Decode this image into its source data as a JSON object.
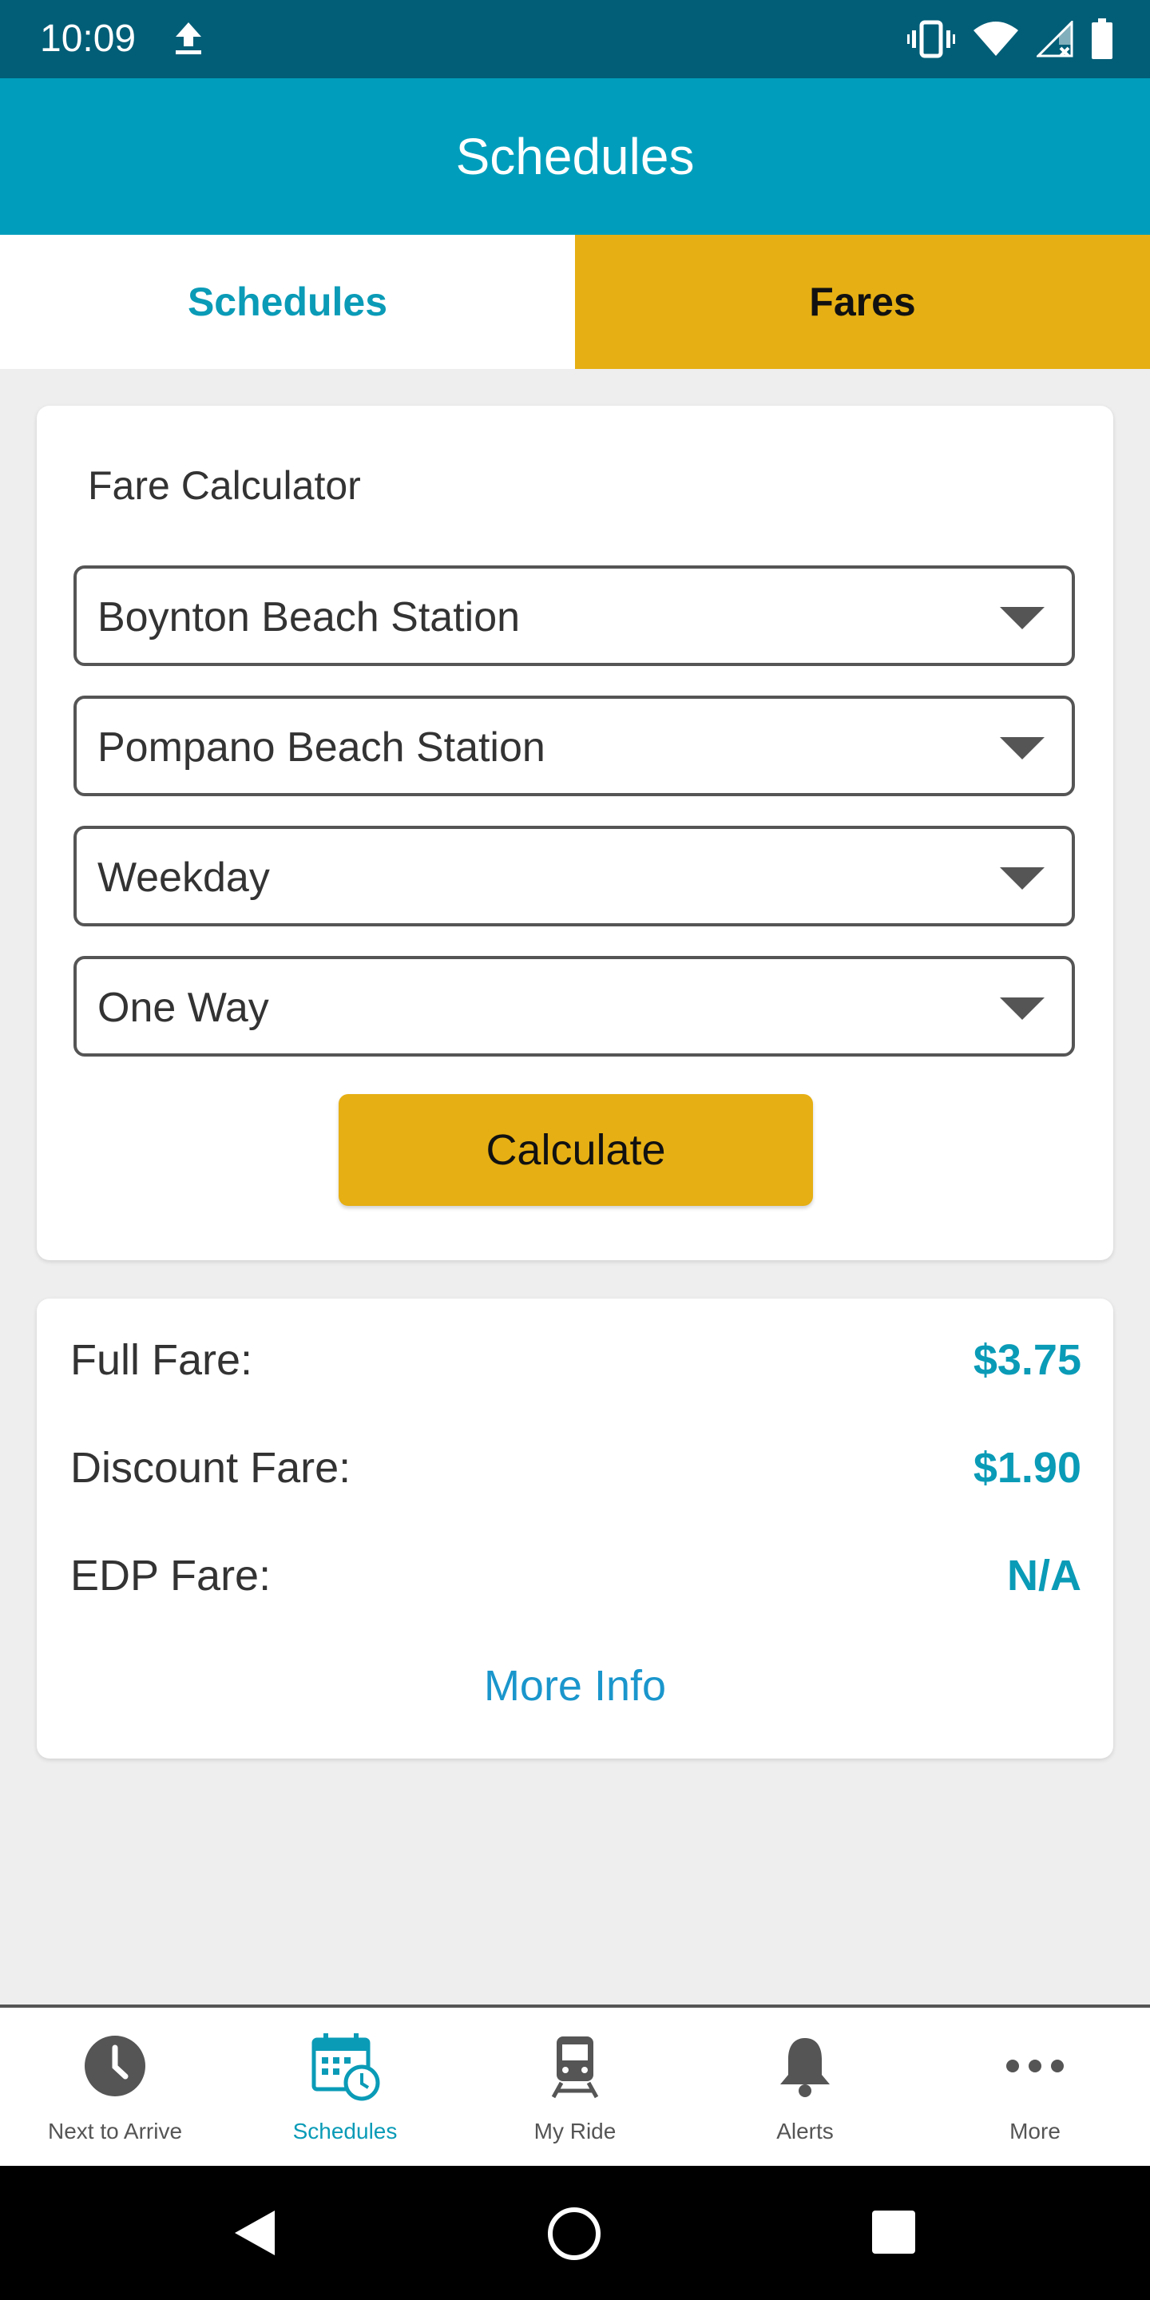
{
  "status_bar": {
    "time": "10:09",
    "icons": [
      "upload-icon",
      "vibrate-icon",
      "wifi-icon",
      "signal-no-data-icon",
      "battery-icon"
    ]
  },
  "app_bar": {
    "title": "Schedules"
  },
  "tabs": [
    {
      "label": "Schedules",
      "active": true
    },
    {
      "label": "Fares",
      "active": false
    }
  ],
  "fare_calculator": {
    "title": "Fare Calculator",
    "origin": "Boynton Beach Station",
    "destination": "Pompano Beach Station",
    "day_type": "Weekday",
    "trip_type": "One Way",
    "calculate_label": "Calculate"
  },
  "results": {
    "rows": [
      {
        "label": "Full Fare:",
        "value": "$3.75"
      },
      {
        "label": "Discount Fare:",
        "value": "$1.90"
      },
      {
        "label": "EDP Fare:",
        "value": "N/A"
      }
    ],
    "more_info_label": "More Info"
  },
  "bottom_nav": [
    {
      "label": "Next to Arrive",
      "icon": "clock-icon",
      "active": false
    },
    {
      "label": "Schedules",
      "icon": "calendar-clock-icon",
      "active": true
    },
    {
      "label": "My Ride",
      "icon": "train-icon",
      "active": false
    },
    {
      "label": "Alerts",
      "icon": "bell-icon",
      "active": false
    },
    {
      "label": "More",
      "icon": "more-dots-icon",
      "active": false
    }
  ],
  "colors": {
    "status_bar": "#025e77",
    "app_bar": "#009ebc",
    "accent_teal": "#0a9bb7",
    "accent_yellow": "#e6af13",
    "link_blue": "#1a96cc"
  }
}
